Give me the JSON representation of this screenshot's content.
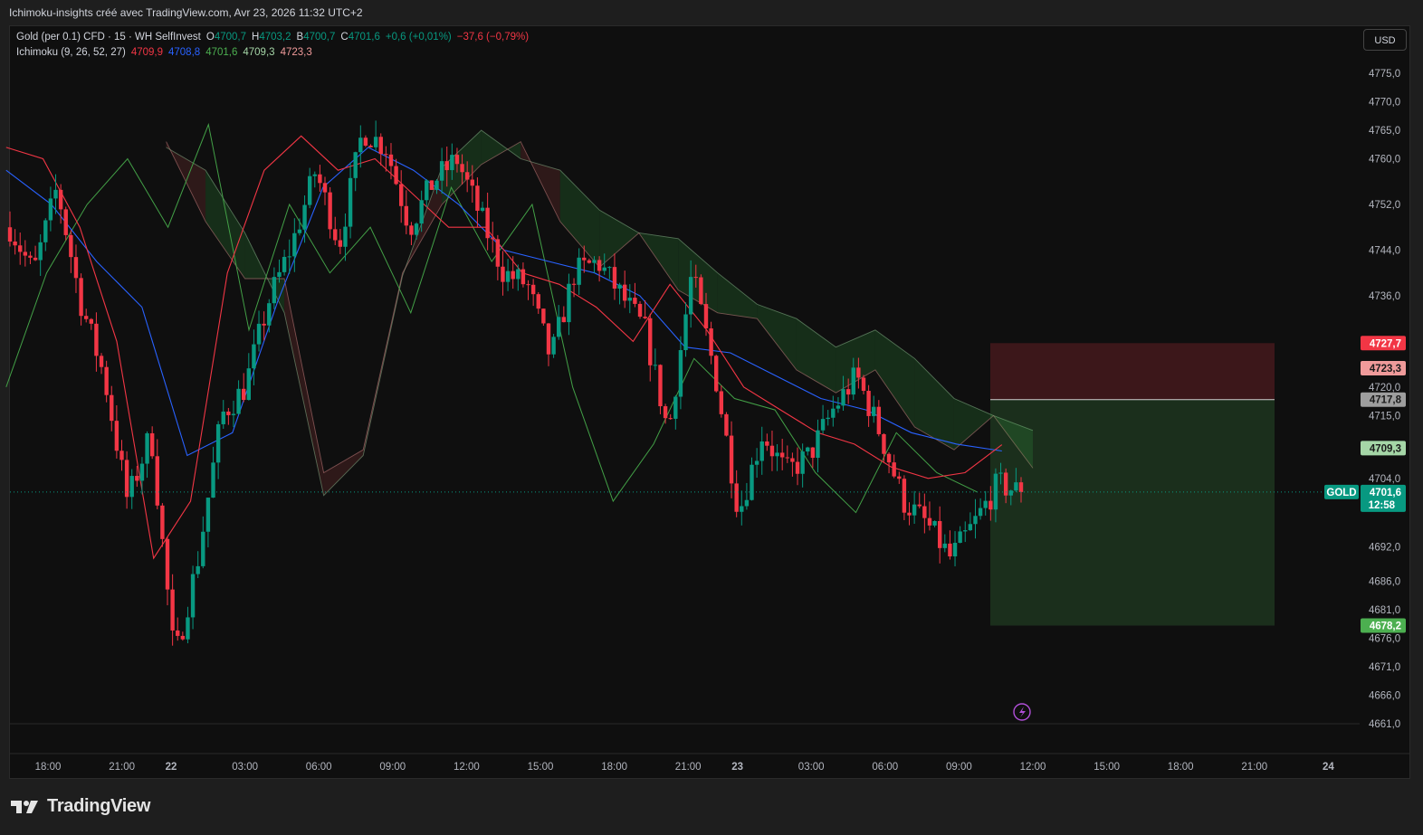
{
  "header": {
    "caption": "Ichimoku-insights créé avec TradingView.com, Avr 23, 2026 11:32 UTC+2"
  },
  "legend": {
    "symbol": "Gold (per 0.1) CFD · 15 · WH SelfInvest",
    "ohlc": [
      {
        "label": "O",
        "value": "4700,7"
      },
      {
        "label": "H",
        "value": "4703,2"
      },
      {
        "label": "B",
        "value": "4700,7"
      },
      {
        "label": "C",
        "value": "4701,6"
      }
    ],
    "change": "+0,6 (+0,01%)",
    "change2": "−37,6 (−0,79%)",
    "indicator": "Ichimoku (9, 26, 52, 27)",
    "indicator_values": [
      {
        "value": "4709,9",
        "color": "#f23645"
      },
      {
        "value": "4708,8",
        "color": "#2962ff"
      },
      {
        "value": "4701,6",
        "color": "#4caf50"
      },
      {
        "value": "4709,3",
        "color": "#a5d6a7"
      },
      {
        "value": "4723,3",
        "color": "#ef9a9a"
      }
    ]
  },
  "currency_button": "USD",
  "brand": "TradingView",
  "colors": {
    "up": "#089981",
    "down": "#f23645",
    "tenkan": "#f23645",
    "kijun": "#2962ff",
    "chikou": "#43a047",
    "cloud_bull": "#1a3a1e",
    "cloud_bear": "#3a1e1e",
    "current": "#089981"
  },
  "chart_data": {
    "type": "candlestick",
    "symbol": "GOLD",
    "y_axis": {
      "min": 4661,
      "max": 4778,
      "ticks": [
        4775,
        4770,
        4765,
        4760,
        4752,
        4744,
        4736,
        4720,
        4715,
        4704,
        4692,
        4686,
        4681,
        4676,
        4671,
        4666,
        4661
      ],
      "labels": [
        "4775,0",
        "4770,0",
        "4765,0",
        "4760,0",
        "4752,0",
        "4744,0",
        "4736,0",
        "4720,0",
        "4715,0",
        "4704,0",
        "4692,0",
        "4686,0",
        "4681,0",
        "4676,0",
        "4671,0",
        "4666,0",
        "4661,0"
      ]
    },
    "x_axis": {
      "labels": [
        "18:00",
        "21:00",
        "22",
        "03:00",
        "06:00",
        "09:00",
        "12:00",
        "15:00",
        "18:00",
        "21:00",
        "23",
        "03:00",
        "06:00",
        "09:00",
        "12:00",
        "15:00",
        "18:00",
        "21:00",
        "24"
      ],
      "positions": [
        0,
        3,
        5,
        8,
        11,
        14,
        17,
        20,
        23,
        26,
        28,
        31,
        34,
        37,
        40,
        43,
        46,
        49,
        52
      ]
    },
    "price_labels": [
      {
        "value": 4727.7,
        "text": "4727,7",
        "bg": "#f23645",
        "fg": "#ffffff"
      },
      {
        "value": 4723.3,
        "text": "4723,3",
        "bg": "#ef9a9a",
        "fg": "#1a1a1a"
      },
      {
        "value": 4717.8,
        "text": "4717,8",
        "bg": "#9e9e9e",
        "fg": "#1a1a1a"
      },
      {
        "value": 4709.3,
        "text": "4709,3",
        "bg": "#a5d6a7",
        "fg": "#1a1a1a"
      },
      {
        "value": 4701.6,
        "text": "4701,6",
        "bg": "#089981",
        "fg": "#ffffff",
        "sub": "12:58"
      },
      {
        "value": 4678.2,
        "text": "4678,2",
        "bg": "#4caf50",
        "fg": "#ffffff"
      }
    ],
    "current_price": 4701.6,
    "countdown": "12:58",
    "position": {
      "entry": 4717.8,
      "stop": 4727.7,
      "target": 4678.2
    },
    "price_path": [
      4748,
      4740,
      4755,
      4735,
      4722,
      4700,
      4712,
      4672,
      4690,
      4715,
      4720,
      4735,
      4745,
      4758,
      4745,
      4765,
      4762,
      4748,
      4756,
      4760,
      4750,
      4740,
      4738,
      4725,
      4740,
      4742,
      4736,
      4730,
      4712,
      4740,
      4722,
      4698,
      4712,
      4705,
      4708,
      4716,
      4722,
      4712,
      4700,
      4696,
      4690,
      4696,
      4703,
      4701.6
    ],
    "tenkan_path": [
      4762,
      4760,
      4748,
      4728,
      4690,
      4700,
      4740,
      4758,
      4764,
      4758,
      4760,
      4754,
      4748,
      4748,
      4740,
      4738,
      4734,
      4728,
      4738,
      4730,
      4720,
      4716,
      4712,
      4710,
      4706,
      4704,
      4705,
      4709.9
    ],
    "kijun_path": [
      4758,
      4752,
      4742,
      4734,
      4708,
      4712,
      4735,
      4755,
      4762,
      4758,
      4752,
      4744,
      4742,
      4740,
      4736,
      4727,
      4726,
      4722,
      4718,
      4716,
      4712,
      4710,
      4708.8
    ],
    "chikou_path": [
      4720,
      4740,
      4752,
      4760,
      4748,
      4766,
      4730,
      4752,
      4740,
      4748,
      4733,
      4755,
      4742,
      4752,
      4720,
      4700,
      4710,
      4725,
      4718,
      4716,
      4705,
      4698,
      4712,
      4705,
      4701.6
    ]
  }
}
